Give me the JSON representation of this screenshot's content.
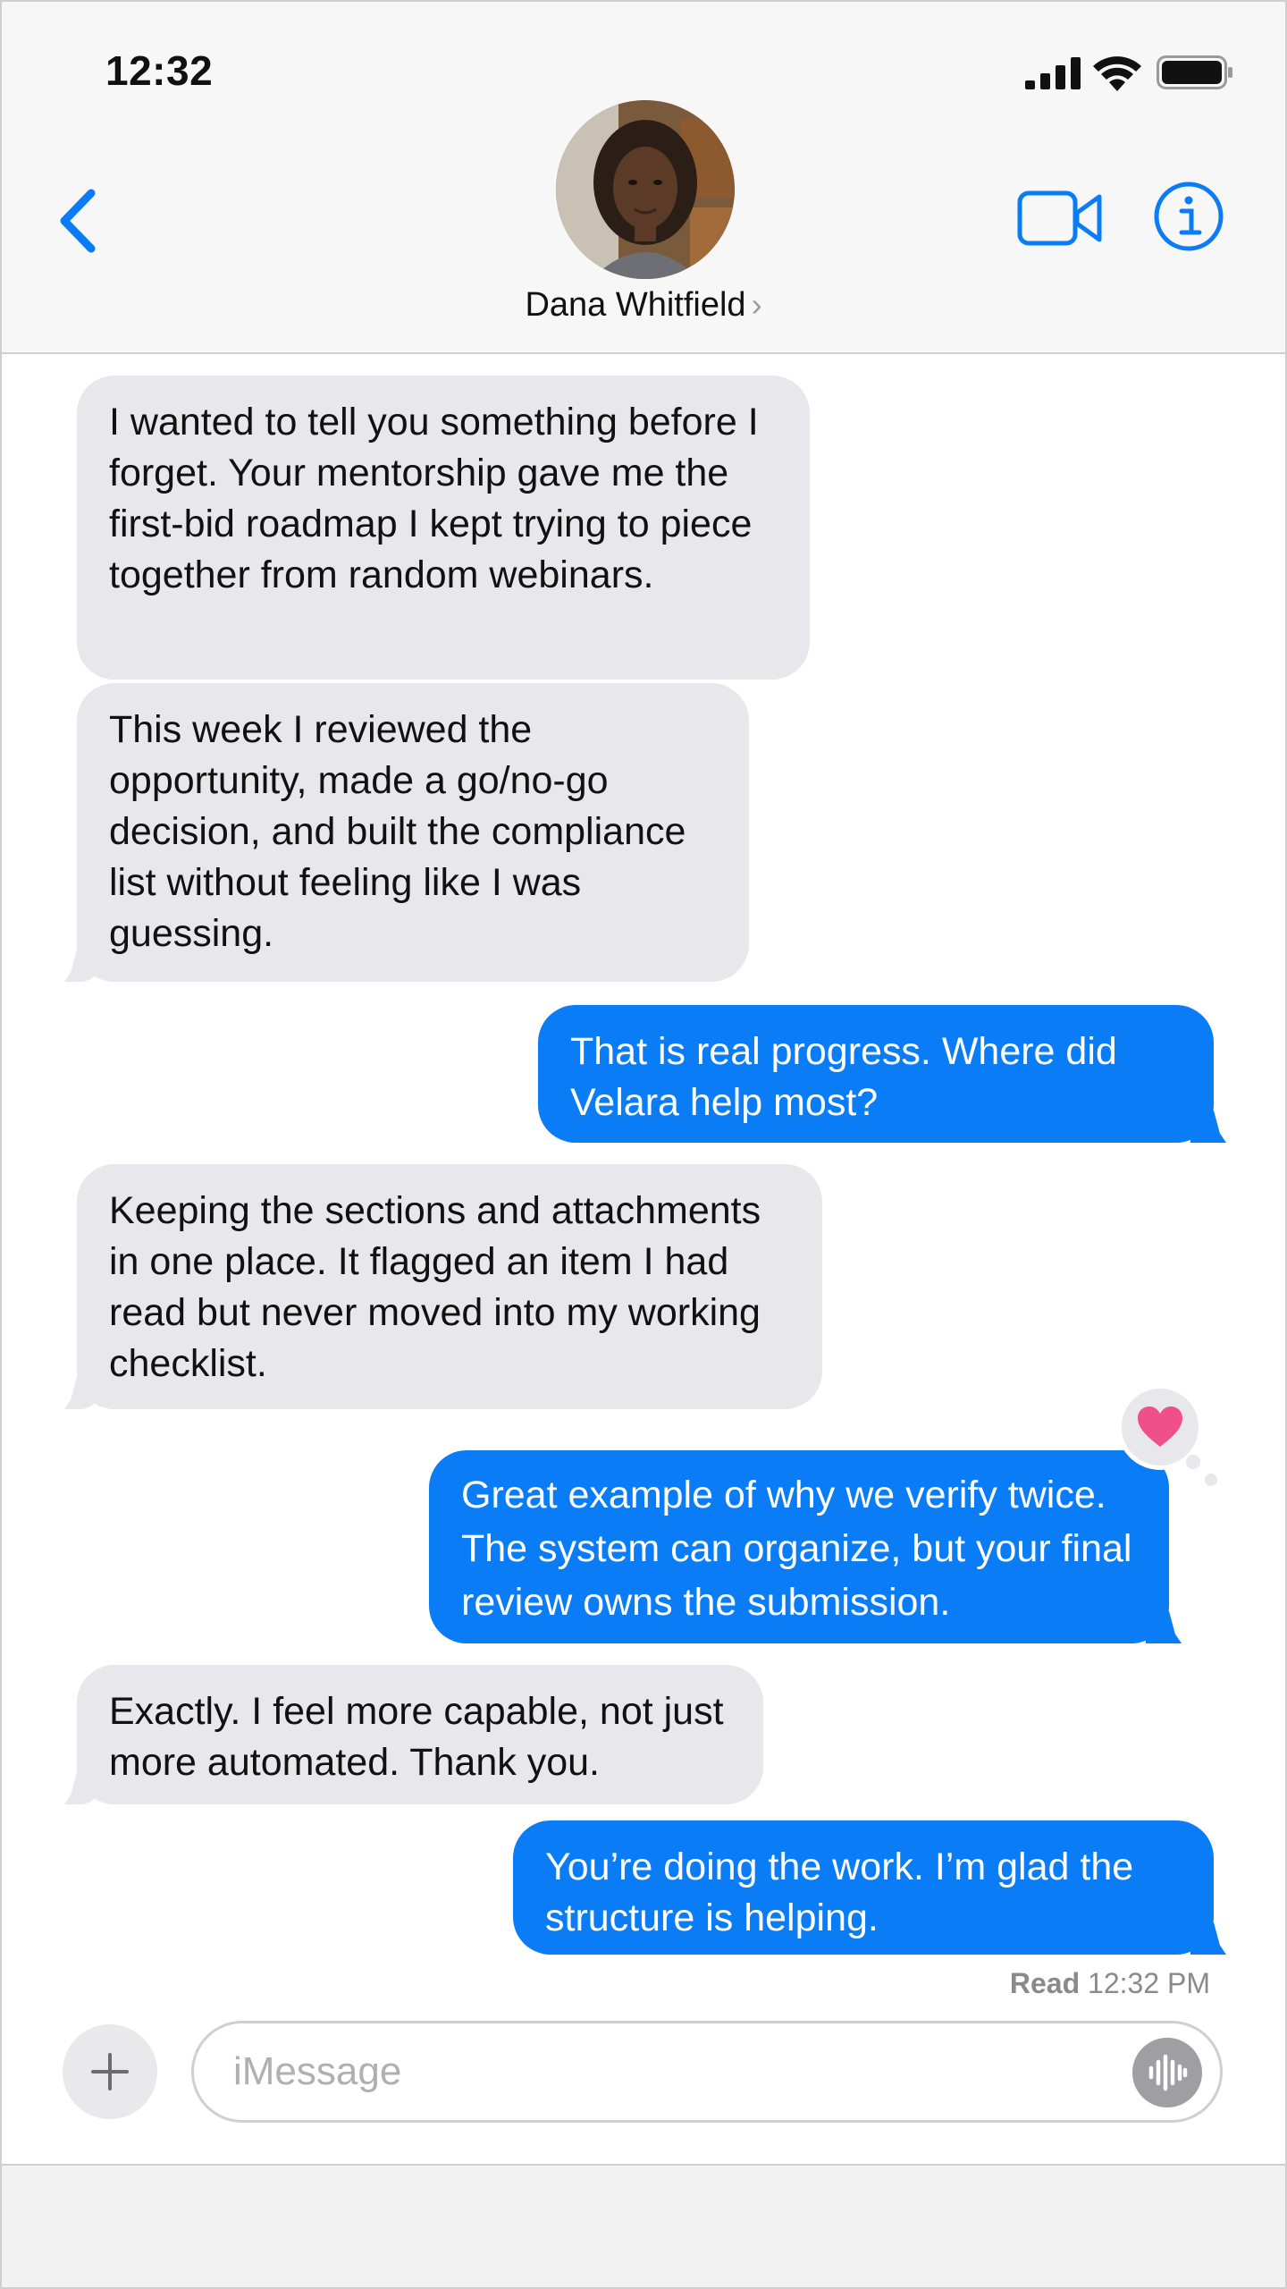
{
  "status_bar": {
    "time": "12:32"
  },
  "header": {
    "contact_name": "Dana Whitfield",
    "name_chevron": "›"
  },
  "messages": [
    {
      "direction": "in",
      "text": "I wanted to tell you something before I forget. Your mentorship gave me the first-bid roadmap I kept trying to piece together from random webinars."
    },
    {
      "direction": "in",
      "text": "This week I reviewed the opportunity, made a go/no-go decision, and built the compliance list without feeling like I was guessing."
    },
    {
      "direction": "out",
      "text": "That is real progress. Where did Velara help most?"
    },
    {
      "direction": "in",
      "text": "Keeping the sections and attachments in one place. It flagged an item I had read but never moved into my working checklist."
    },
    {
      "direction": "out",
      "text": "Great example of why we verify twice. The system can organize, but your final review owns the submission.",
      "reaction": "heart"
    },
    {
      "direction": "in",
      "text": "Exactly. I feel more capable, not just more automated. Thank you."
    },
    {
      "direction": "out",
      "text": "You’re doing the work. I’m glad the structure is helping."
    }
  ],
  "read_receipt": {
    "label": "Read",
    "time": "12:32 PM"
  },
  "composer": {
    "placeholder": "iMessage"
  },
  "colors": {
    "accent": "#0a7cf5",
    "incoming_bubble": "#e8e8ec",
    "reaction_heart": "#f0508a"
  }
}
